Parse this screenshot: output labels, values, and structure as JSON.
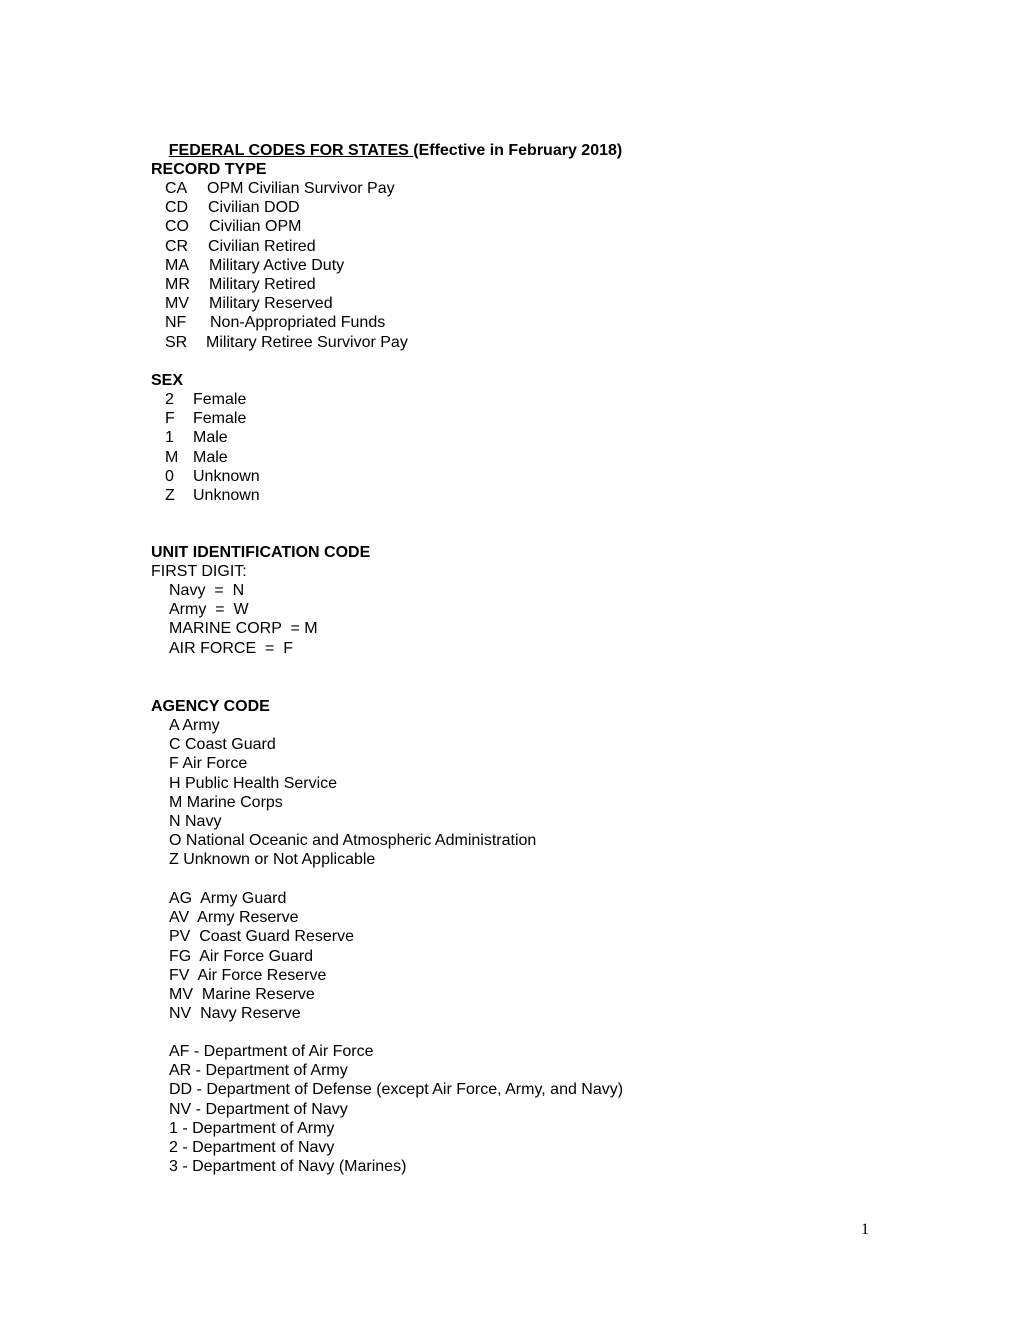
{
  "title": {
    "underlined": "FEDERAL CODES FOR STATES ",
    "rest": "(Effective in February 2018)"
  },
  "record_type": {
    "heading": "RECORD TYPE",
    "items": [
      {
        "code": "CA",
        "label": "OPM Civilian Survivor Pay"
      },
      {
        "code": "CD",
        "label": "Civilian DOD"
      },
      {
        "code": "CO",
        "label": "Civilian OPM"
      },
      {
        "code": "CR",
        "label": "Civilian Retired"
      },
      {
        "code": "MA",
        "label": "Military Active Duty"
      },
      {
        "code": "MR",
        "label": "Military Retired"
      },
      {
        "code": "MV",
        "label": "Military Reserved"
      },
      {
        "code": "NF",
        "label": "Non-Appropriated Funds"
      },
      {
        "code": "SR",
        "label": "Military Retiree Survivor Pay"
      }
    ]
  },
  "sex": {
    "heading": "SEX",
    "items": [
      {
        "code": "2",
        "label": "Female"
      },
      {
        "code": "F",
        "label": "Female"
      },
      {
        "code": "1",
        "label": "Male"
      },
      {
        "code": "M",
        "label": "Male"
      },
      {
        "code": "0",
        "label": "Unknown"
      },
      {
        "code": "Z",
        "label": "Unknown"
      }
    ]
  },
  "unit_id": {
    "heading": "UNIT IDENTIFICATION CODE",
    "subheading": "FIRST DIGIT:",
    "items": [
      "Navy  =  N",
      "Army  =  W",
      "MARINE CORP  = M",
      "AIR FORCE  =  F"
    ]
  },
  "agency_code": {
    "heading": "AGENCY CODE",
    "group1": [
      "A Army",
      "C Coast Guard",
      "F Air Force",
      "H Public Health Service",
      "M Marine Corps",
      "N Navy",
      "O National Oceanic and Atmospheric Administration",
      "Z Unknown or Not Applicable"
    ],
    "group2": [
      "AG  Army Guard",
      "AV  Army Reserve",
      "PV  Coast Guard Reserve",
      "FG  Air Force Guard",
      "FV  Air Force Reserve",
      "MV  Marine Reserve",
      "NV  Navy Reserve"
    ],
    "group3": [
      "AF - Department of Air Force",
      "AR - Department of Army",
      "DD - Department of Defense (except Air Force, Army, and Navy)",
      "NV - Department of Navy",
      "1 - Department of Army",
      "2 - Department of Navy",
      "3 - Department of Navy (Marines)"
    ]
  },
  "page_number": "1"
}
